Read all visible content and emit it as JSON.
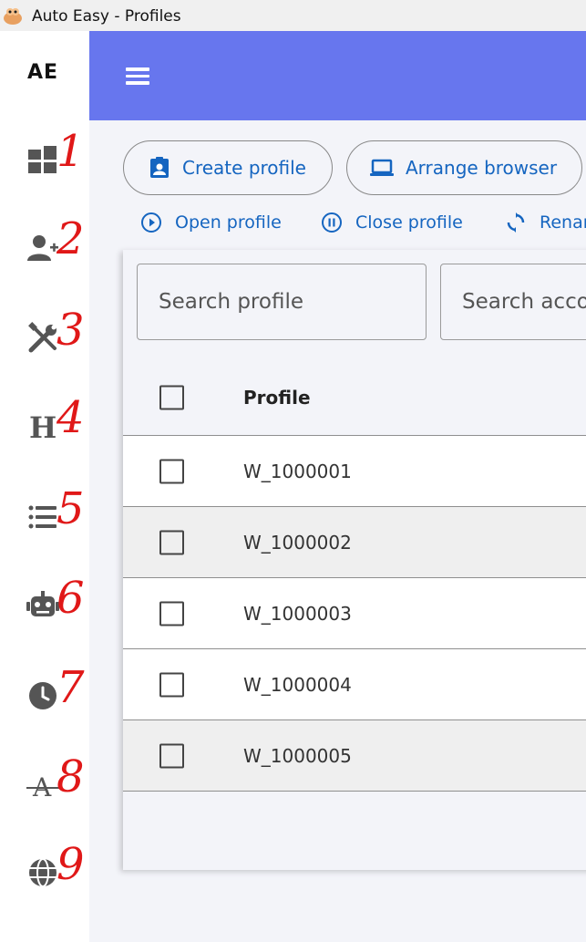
{
  "window": {
    "title": "Auto Easy - Profiles"
  },
  "sidebar": {
    "logo": "AE",
    "items": [
      {
        "icon": "dashboard-icon",
        "annotation": "1"
      },
      {
        "icon": "add-user-icon",
        "annotation": "2"
      },
      {
        "icon": "tools-icon",
        "annotation": "3"
      },
      {
        "icon": "heading-icon",
        "annotation": "4"
      },
      {
        "icon": "list-icon",
        "annotation": "5"
      },
      {
        "icon": "robot-icon",
        "annotation": "6"
      },
      {
        "icon": "clock-icon",
        "annotation": "7"
      },
      {
        "icon": "strikethrough-icon",
        "annotation": "8"
      },
      {
        "icon": "globe-icon",
        "annotation": "9"
      }
    ]
  },
  "topbar": {
    "menu_icon": "hamburger-icon"
  },
  "toolbar": {
    "create_profile": "Create profile",
    "arrange_browser": "Arrange browser",
    "open_profile": "Open profile",
    "close_profile": "Close profile",
    "rename": "Renam"
  },
  "search": {
    "profile_placeholder": "Search profile",
    "account_placeholder": "Search acco"
  },
  "table": {
    "header": "Profile",
    "rows": [
      "W_1000001",
      "W_1000002",
      "W_1000003",
      "W_1000004",
      "W_1000005"
    ]
  },
  "colors": {
    "topbar": "#6776ee",
    "accent": "#1565c0",
    "annotation": "#e01818",
    "icon": "#555555"
  }
}
